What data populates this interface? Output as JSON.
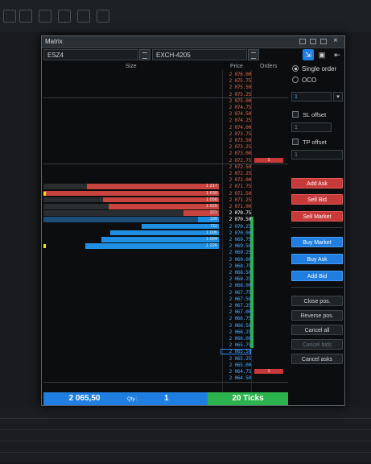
{
  "window": {
    "title": "Matrix"
  },
  "instrument": {
    "symbol": "ESZ4",
    "account": "EXCH-4205"
  },
  "headers": {
    "size": "Size",
    "price": "Price",
    "orders": "Orders"
  },
  "prices": [
    "2 076.00",
    "2 075.75",
    "2 075.50",
    "2 075.25",
    "2 075.00",
    "2 074.75",
    "2 074.50",
    "2 074.25",
    "2 074.00",
    "2 073.75",
    "2 073.50",
    "2 073.25",
    "2 073.00",
    "2 072.75",
    "2 072.50",
    "2 072.25",
    "2 072.00",
    "2 071.75",
    "2 071.50",
    "2 071.25",
    "2 071.00",
    "2 070.75",
    "2 070.50",
    "2 070.25",
    "2 070.00",
    "2 069.75",
    "2 069.50",
    "2 069.25",
    "2 069.00",
    "2 068.75",
    "2 068.50",
    "2 068.25",
    "2 068.00",
    "2 067.75",
    "2 067.50",
    "2 067.25",
    "2 067.00",
    "2 066.75",
    "2 066.50",
    "2 066.25",
    "2 066.00",
    "2 065.75",
    "2 065.50",
    "2 065.25",
    "2 065.00",
    "2 064.75",
    "2 064.50"
  ],
  "asks": [
    {
      "price": "2 071.75",
      "size": "1 217",
      "fill": 0.75
    },
    {
      "price": "2 071.50",
      "size": "1 630",
      "fill": 1.0
    },
    {
      "price": "2 071.25",
      "size": "1 058",
      "fill": 0.66
    },
    {
      "price": "2 071.00",
      "size": "1 025",
      "fill": 0.63
    },
    {
      "price": "2 070.75",
      "size": "321",
      "fill": 0.2
    }
  ],
  "bids": [
    {
      "price": "2 070.50",
      "size": "190",
      "fill": 0.12
    },
    {
      "price": "2 070.25",
      "size": "711",
      "fill": 0.44
    },
    {
      "price": "2 070.00",
      "size": "1 006",
      "fill": 0.62
    },
    {
      "price": "2 069.75",
      "size": "1 094",
      "fill": 0.67
    },
    {
      "price": "2 069.50",
      "size": "1 226",
      "fill": 0.76
    }
  ],
  "orders": [
    {
      "price": "2 072.75",
      "qty": "1"
    },
    {
      "price": "2 064.75",
      "qty": "1"
    }
  ],
  "bottom": {
    "last_price": "2 065,50",
    "qty_label": "Qty.:",
    "qty_value": "1",
    "ticks": "20 Ticks"
  },
  "panel": {
    "order_type_single": "Single order",
    "order_type_oco": "OCO",
    "quantity": "1",
    "sl_label": "SL offset",
    "sl_value": "1",
    "tp_label": "TP offset",
    "tp_value": "1",
    "add_ask": "Add Ask",
    "sell_bid": "Sell Bid",
    "sell_market": "Sell Market",
    "buy_market": "Buy Market",
    "buy_ask": "Buy Ask",
    "add_bid": "Add Bid",
    "close_pos": "Close pos.",
    "reverse_pos": "Reverse pos.",
    "cancel_all": "Cancel all",
    "cancel_bids": "Cancel bids",
    "cancel_asks": "Cancel asks"
  },
  "colors": {
    "ask": "#c9443f",
    "bid": "#1f8fe4",
    "ticks_green": "#2db34e",
    "price_red": "#e0684f",
    "price_blue": "#4aa6ff"
  }
}
